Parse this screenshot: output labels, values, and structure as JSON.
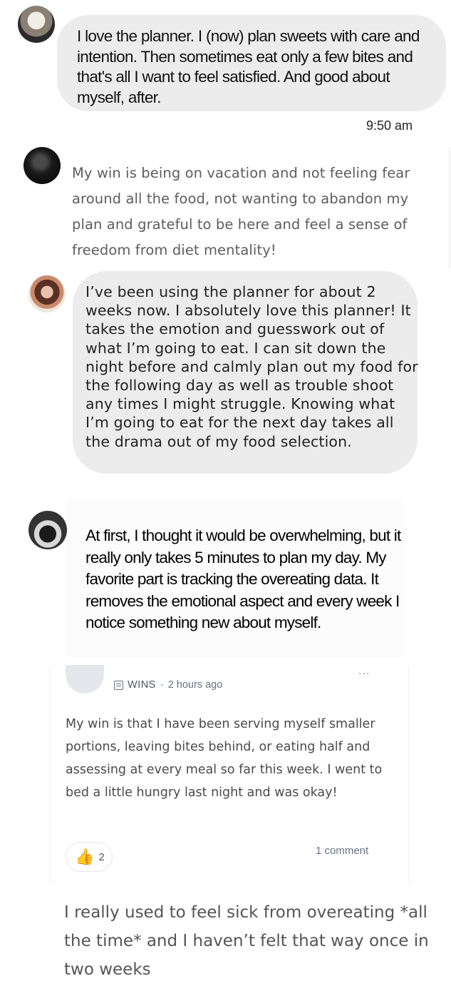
{
  "testimonials": [
    {
      "text": "I love the planner. I  (now) plan sweets  with care and intention. Then sometimes eat only a few bites and that's all I want to feel satisfied. And good about myself, after.",
      "time": "9:50 am"
    },
    {
      "text": "My win is being on vacation and not feeling fear around all the food, not wanting to abandon my plan and grateful to be here and feel a sense of freedom from diet mentality!"
    },
    {
      "text": "I’ve been using the planner for about 2 weeks now. I absolutely love this planner! It takes the emotion and guesswork out of what I’m going to eat. I can sit down the night before and calmly plan out my food for the following day as well as trouble shoot  any times I might struggle. Knowing what I’m going to eat for the next day takes all the drama out of my food selection."
    },
    {
      "text": "At first, I thought it would be overwhelming, but it really only takes 5 minutes to plan my day. My favorite part is tracking the overeating data. It removes the emotional aspect and every week I notice something new about myself."
    },
    {
      "category": "WINS",
      "separator": "·",
      "posted": "2 hours ago",
      "more": "...",
      "text": "My win is that I have been serving myself smaller portions, leaving bites behind, or eating half and assessing at every meal so far this week. I went to bed a little hungry last night and was okay!",
      "likes_icon": "thumbs-up-icon",
      "likes": "2",
      "comments": "1 comment"
    },
    {
      "text": "I really used to feel sick from overeating *all the time* and I haven’t felt that way once in two weeks"
    }
  ],
  "colors": {
    "bubble": "#ececec",
    "muted_text": "#5d5d5d",
    "meta_text": "#6b7280"
  }
}
